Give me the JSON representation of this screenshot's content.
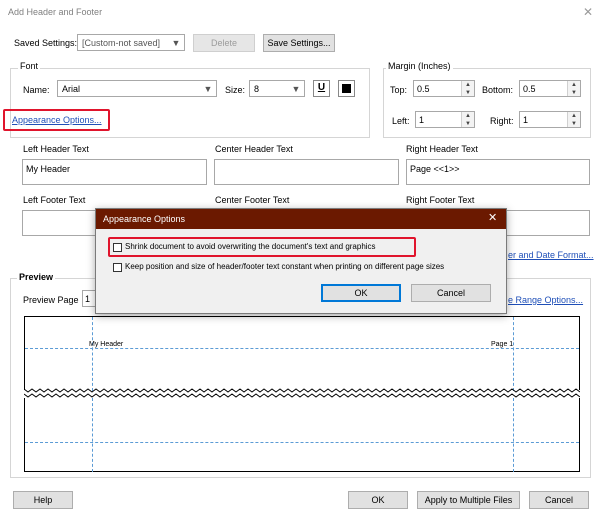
{
  "window": {
    "title": "Add Header and Footer",
    "close_glyph": "✕"
  },
  "saved_settings": {
    "label": "Saved Settings:",
    "value": "[Custom-not saved]",
    "delete_label": "Delete",
    "save_label": "Save Settings..."
  },
  "font": {
    "group_label": "Font",
    "name_label": "Name:",
    "name_value": "Arial",
    "size_label": "Size:",
    "size_value": "8",
    "underline_glyph": "U"
  },
  "margin": {
    "group_label": "Margin (Inches)",
    "top_label": "Top:",
    "top_value": "0.5",
    "bottom_label": "Bottom:",
    "bottom_value": "0.5",
    "left_label": "Left:",
    "left_value": "1",
    "right_label": "Right:",
    "right_value": "1"
  },
  "appearance_options_link": "Appearance Options...",
  "header_text": {
    "left_label": "Left Header Text",
    "left_value": "My Header",
    "center_label": "Center Header Text",
    "center_value": "",
    "right_label": "Right Header Text",
    "right_value": "Page <<1>>"
  },
  "footer_text": {
    "left_label": "Left Footer Text",
    "center_label": "Center Footer Text",
    "right_label": "Right Footer Text"
  },
  "links": {
    "date_format_partial": "er and Date Format...",
    "page_range_partial": "e Range Options..."
  },
  "preview": {
    "group_label": "Preview",
    "page_label": "Preview Page",
    "page_value": "1",
    "header_left": "My Header",
    "header_right": "Page 1"
  },
  "dialog": {
    "title": "Appearance Options",
    "close_glyph": "✕",
    "shrink_label": "Shrink document to avoid overwriting  the document's text and graphics",
    "keep_label": "Keep position and size of header/footer text constant when printing on different page sizes",
    "ok_label": "OK",
    "cancel_label": "Cancel"
  },
  "bottom_buttons": {
    "help": "Help",
    "ok": "OK",
    "apply_multiple": "Apply to Multiple Files",
    "cancel": "Cancel"
  },
  "colors": {
    "dialog_title_bar": "#6b1900",
    "highlight": "#e0142c",
    "link": "#1f4fb8",
    "guide_line": "#5b9bd5"
  }
}
